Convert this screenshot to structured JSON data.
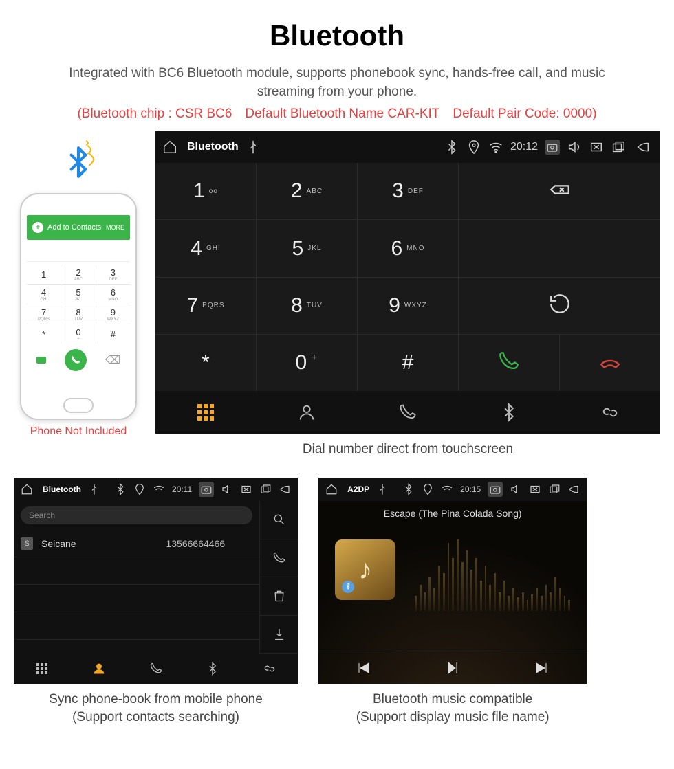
{
  "header": {
    "title": "Bluetooth",
    "subtitle": "Integrated with BC6 Bluetooth module, supports phonebook sync, hands-free call, and music streaming from your phone.",
    "specline": "(Bluetooth chip : CSR BC6 Default Bluetooth Name CAR-KIT Default Pair Code: 0000)"
  },
  "phone_mock": {
    "add_label": "Add to Contacts",
    "more_label": "MORE",
    "keys": [
      {
        "n": "1",
        "s": ""
      },
      {
        "n": "2",
        "s": "ABC"
      },
      {
        "n": "3",
        "s": "DEF"
      },
      {
        "n": "4",
        "s": "GHI"
      },
      {
        "n": "5",
        "s": "JKL"
      },
      {
        "n": "6",
        "s": "MNO"
      },
      {
        "n": "7",
        "s": "PQRS"
      },
      {
        "n": "8",
        "s": "TUV"
      },
      {
        "n": "9",
        "s": "WXYZ"
      },
      {
        "n": "*",
        "s": ""
      },
      {
        "n": "0",
        "s": "+"
      },
      {
        "n": "#",
        "s": ""
      }
    ],
    "note": "Phone Not Included"
  },
  "dialer": {
    "app_name": "Bluetooth",
    "time": "20:12",
    "keys": [
      {
        "n": "1",
        "s": "oo"
      },
      {
        "n": "2",
        "s": "ABC"
      },
      {
        "n": "3",
        "s": "DEF"
      },
      {
        "n": "4",
        "s": "GHI"
      },
      {
        "n": "5",
        "s": "JKL"
      },
      {
        "n": "6",
        "s": "MNO"
      },
      {
        "n": "7",
        "s": "PQRS"
      },
      {
        "n": "8",
        "s": "TUV"
      },
      {
        "n": "9",
        "s": "WXYZ"
      },
      {
        "n": "*",
        "s": ""
      },
      {
        "n": "0",
        "s": "+",
        "plus": true
      },
      {
        "n": "#",
        "s": ""
      }
    ],
    "caption": "Dial number direct from touchscreen"
  },
  "contacts": {
    "app_name": "Bluetooth",
    "time": "20:11",
    "search_placeholder": "Search",
    "rows": [
      {
        "tag": "S",
        "name": "Seicane",
        "number": "13566664466"
      }
    ],
    "caption_l1": "Sync phone-book from mobile phone",
    "caption_l2": "(Support contacts searching)"
  },
  "music": {
    "app_name": "A2DP",
    "time": "20:15",
    "song": "Escape (The Pina Colada Song)",
    "caption_l1": "Bluetooth music compatible",
    "caption_l2": "(Support display music file name)"
  }
}
